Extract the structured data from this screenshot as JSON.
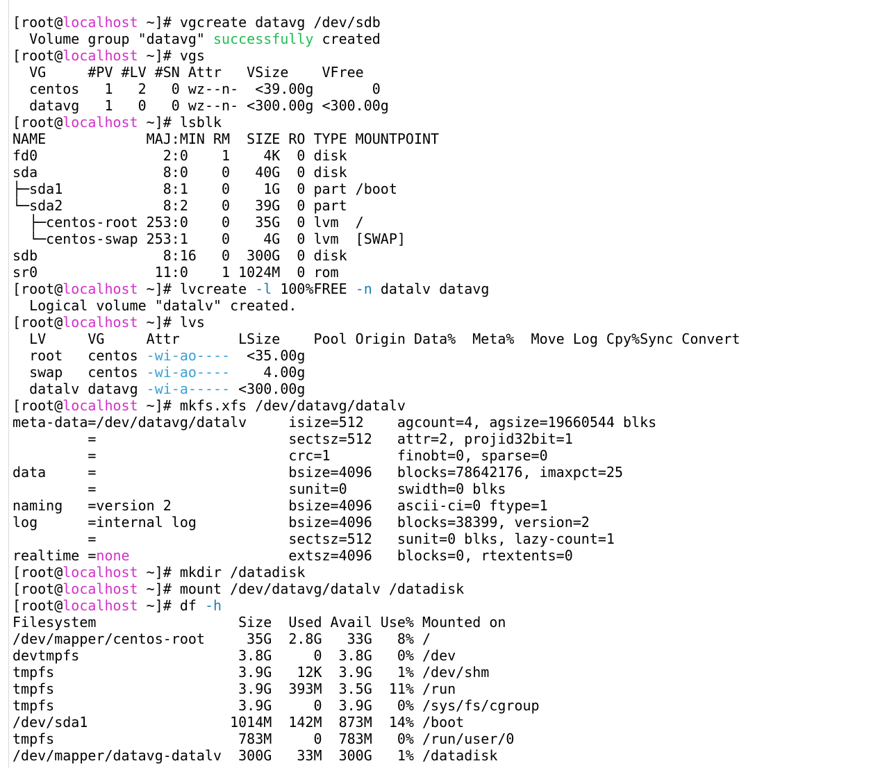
{
  "terminal": {
    "colors": {
      "host": "#d331c8",
      "success": "#1fbd52",
      "option": "#1d7fb3",
      "lv_attr": "#3aa0d6",
      "none": "#d331c8",
      "text": "#000000"
    },
    "lines": [
      [
        {
          "t": "[root@",
          "c": "plain"
        },
        {
          "t": "localhost",
          "c": "host"
        },
        {
          "t": " ~]# vgcreate datavg /dev/sdb",
          "c": "plain"
        }
      ],
      [
        {
          "t": "  Volume group \"datavg\" ",
          "c": "plain"
        },
        {
          "t": "successfully",
          "c": "ok"
        },
        {
          "t": " created",
          "c": "plain"
        }
      ],
      [
        {
          "t": "[root@",
          "c": "plain"
        },
        {
          "t": "localhost",
          "c": "host"
        },
        {
          "t": " ~]# vgs",
          "c": "plain"
        }
      ],
      [
        {
          "t": "  VG     #PV #LV #SN Attr   VSize    VFree",
          "c": "plain"
        }
      ],
      [
        {
          "t": "  centos   1   2   0 wz--n-  <39.00g       0",
          "c": "plain"
        }
      ],
      [
        {
          "t": "  datavg   1   0   0 wz--n- <300.00g <300.00g",
          "c": "plain"
        }
      ],
      [
        {
          "t": "[root@",
          "c": "plain"
        },
        {
          "t": "localhost",
          "c": "host"
        },
        {
          "t": " ~]# lsblk",
          "c": "plain"
        }
      ],
      [
        {
          "t": "NAME            MAJ:MIN RM  SIZE RO TYPE MOUNTPOINT",
          "c": "plain"
        }
      ],
      [
        {
          "t": "fd0               2:0    1    4K  0 disk",
          "c": "plain"
        }
      ],
      [
        {
          "t": "sda               8:0    0   40G  0 disk",
          "c": "plain"
        }
      ],
      [
        {
          "t": "├─sda1            8:1    0    1G  0 part /boot",
          "c": "plain"
        }
      ],
      [
        {
          "t": "└─sda2            8:2    0   39G  0 part",
          "c": "plain"
        }
      ],
      [
        {
          "t": "  ├─centos-root 253:0    0   35G  0 lvm  /",
          "c": "plain"
        }
      ],
      [
        {
          "t": "  └─centos-swap 253:1    0    4G  0 lvm  [SWAP]",
          "c": "plain"
        }
      ],
      [
        {
          "t": "sdb               8:16   0  300G  0 disk",
          "c": "plain"
        }
      ],
      [
        {
          "t": "sr0              11:0    1 1024M  0 rom",
          "c": "plain"
        }
      ],
      [
        {
          "t": "[root@",
          "c": "plain"
        },
        {
          "t": "localhost",
          "c": "host"
        },
        {
          "t": " ~]# lvcreate ",
          "c": "plain"
        },
        {
          "t": "-l",
          "c": "opt"
        },
        {
          "t": " 100%FREE ",
          "c": "plain"
        },
        {
          "t": "-n",
          "c": "opt"
        },
        {
          "t": " datalv datavg",
          "c": "plain"
        }
      ],
      [
        {
          "t": "  Logical volume \"datalv\" created.",
          "c": "plain"
        }
      ],
      [
        {
          "t": "[root@",
          "c": "plain"
        },
        {
          "t": "localhost",
          "c": "host"
        },
        {
          "t": " ~]# lvs",
          "c": "plain"
        }
      ],
      [
        {
          "t": "  LV     VG     Attr       LSize    Pool Origin Data%  Meta%  Move Log Cpy%Sync Convert",
          "c": "plain"
        }
      ],
      [
        {
          "t": "  root   centos ",
          "c": "plain"
        },
        {
          "t": "-wi-ao----",
          "c": "attr"
        },
        {
          "t": "  <35.00g",
          "c": "plain"
        }
      ],
      [
        {
          "t": "  swap   centos ",
          "c": "plain"
        },
        {
          "t": "-wi-ao----",
          "c": "attr"
        },
        {
          "t": "    4.00g",
          "c": "plain"
        }
      ],
      [
        {
          "t": "  datalv datavg ",
          "c": "plain"
        },
        {
          "t": "-wi-a-----",
          "c": "attr"
        },
        {
          "t": " <300.00g",
          "c": "plain"
        }
      ],
      [
        {
          "t": "[root@",
          "c": "plain"
        },
        {
          "t": "localhost",
          "c": "host"
        },
        {
          "t": " ~]# mkfs.xfs /dev/datavg/datalv",
          "c": "plain"
        }
      ],
      [
        {
          "t": "meta-data=/dev/datavg/datalv     isize=512    agcount=4, agsize=19660544 blks",
          "c": "plain"
        }
      ],
      [
        {
          "t": "         =                       sectsz=512   attr=2, projid32bit=1",
          "c": "plain"
        }
      ],
      [
        {
          "t": "         =                       crc=1        finobt=0, sparse=0",
          "c": "plain"
        }
      ],
      [
        {
          "t": "data     =                       bsize=4096   blocks=78642176, imaxpct=25",
          "c": "plain"
        }
      ],
      [
        {
          "t": "         =                       sunit=0      swidth=0 blks",
          "c": "plain"
        }
      ],
      [
        {
          "t": "naming   =version 2              bsize=4096   ascii-ci=0 ftype=1",
          "c": "plain"
        }
      ],
      [
        {
          "t": "log      =internal log           bsize=4096   blocks=38399, version=2",
          "c": "plain"
        }
      ],
      [
        {
          "t": "         =                       sectsz=512   sunit=0 blks, lazy-count=1",
          "c": "plain"
        }
      ],
      [
        {
          "t": "realtime =",
          "c": "plain"
        },
        {
          "t": "none",
          "c": "none"
        },
        {
          "t": "                   extsz=4096   blocks=0, rtextents=0",
          "c": "plain"
        }
      ],
      [
        {
          "t": "[root@",
          "c": "plain"
        },
        {
          "t": "localhost",
          "c": "host"
        },
        {
          "t": " ~]# mkdir /datadisk",
          "c": "plain"
        }
      ],
      [
        {
          "t": "[root@",
          "c": "plain"
        },
        {
          "t": "localhost",
          "c": "host"
        },
        {
          "t": " ~]# mount /dev/datavg/datalv /datadisk",
          "c": "plain"
        }
      ],
      [
        {
          "t": "[root@",
          "c": "plain"
        },
        {
          "t": "localhost",
          "c": "host"
        },
        {
          "t": " ~]# df ",
          "c": "plain"
        },
        {
          "t": "-h",
          "c": "opt"
        }
      ],
      [
        {
          "t": "Filesystem                 Size  Used Avail Use% Mounted on",
          "c": "plain"
        }
      ],
      [
        {
          "t": "/dev/mapper/centos-root     35G  2.8G   33G   8% /",
          "c": "plain"
        }
      ],
      [
        {
          "t": "devtmpfs                   3.8G     0  3.8G   0% /dev",
          "c": "plain"
        }
      ],
      [
        {
          "t": "tmpfs                      3.9G   12K  3.9G   1% /dev/shm",
          "c": "plain"
        }
      ],
      [
        {
          "t": "tmpfs                      3.9G  393M  3.5G  11% /run",
          "c": "plain"
        }
      ],
      [
        {
          "t": "tmpfs                      3.9G     0  3.9G   0% /sys/fs/cgroup",
          "c": "plain"
        }
      ],
      [
        {
          "t": "/dev/sda1                 1014M  142M  873M  14% /boot",
          "c": "plain"
        }
      ],
      [
        {
          "t": "tmpfs                      783M     0  783M   0% /run/user/0",
          "c": "plain"
        }
      ],
      [
        {
          "t": "/dev/mapper/datavg-datalv  300G   33M  300G   1% /datadisk",
          "c": "plain"
        }
      ]
    ]
  }
}
